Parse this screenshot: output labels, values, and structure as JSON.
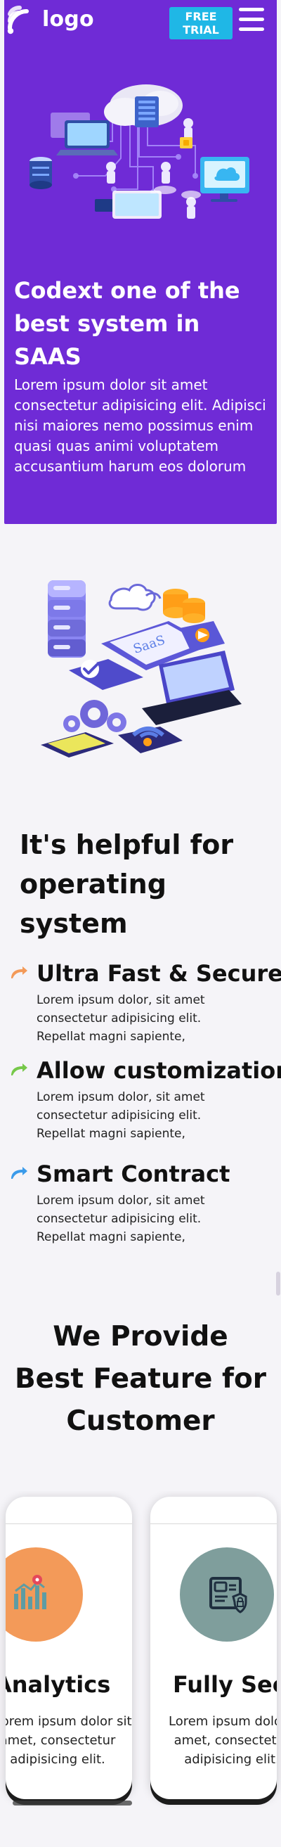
{
  "nav": {
    "brand": "logo",
    "cta_label": "FREE TRIAL",
    "menu_icon": "hamburger-icon"
  },
  "hero": {
    "title": "Codext one of the best system in SAAS",
    "description": "Lorem ipsum dolor sit amet consectetur adipisicing elit. Adipisci nisi maiores nemo possimus enim quasi quas animi voluptatem accusantium harum eos dolorum",
    "illustration": "cloud-network-illustration"
  },
  "illustrations": {
    "saas": "SaaS"
  },
  "helpful": {
    "title": "It's helpful for operating system",
    "features": [
      {
        "title": "Ultra Fast & Secure",
        "text": "Lorem ipsum dolor, sit amet consectetur adipisicing elit. Repellat magni sapiente,",
        "icon": "orange-arrow-icon"
      },
      {
        "title": "Allow customization",
        "text": "Lorem ipsum dolor, sit amet consectetur adipisicing elit. Repellat magni sapiente,",
        "icon": "green-arrow-icon"
      },
      {
        "title": "Smart Contract",
        "text": "Lorem ipsum dolor, sit amet consectetur adipisicing elit. Repellat magni sapiente,",
        "icon": "blue-arrow-icon"
      }
    ]
  },
  "best": {
    "title": "We Provide Best Feature for Customer",
    "cards": [
      {
        "title": "Analytics",
        "lines": [
          "Lorem ipsum dolor sit",
          "amet, consectetur",
          "adipisicing elit."
        ],
        "icon": "analytics-chart-icon"
      },
      {
        "title": "Fully Secure",
        "lines": [
          "Lorem ipsum dolor sit",
          "amet, consectetur",
          "adipisicing elit."
        ],
        "icon": "secure-id-shield-icon"
      }
    ]
  },
  "colors": {
    "hero_purple": "#6F2BD6",
    "cta_blue": "#1FB7E6",
    "orange_accent": "#F39A59",
    "teal_accent": "#7F9E9C",
    "text_dark": "#111111",
    "page_bg": "#F5F4F8"
  }
}
